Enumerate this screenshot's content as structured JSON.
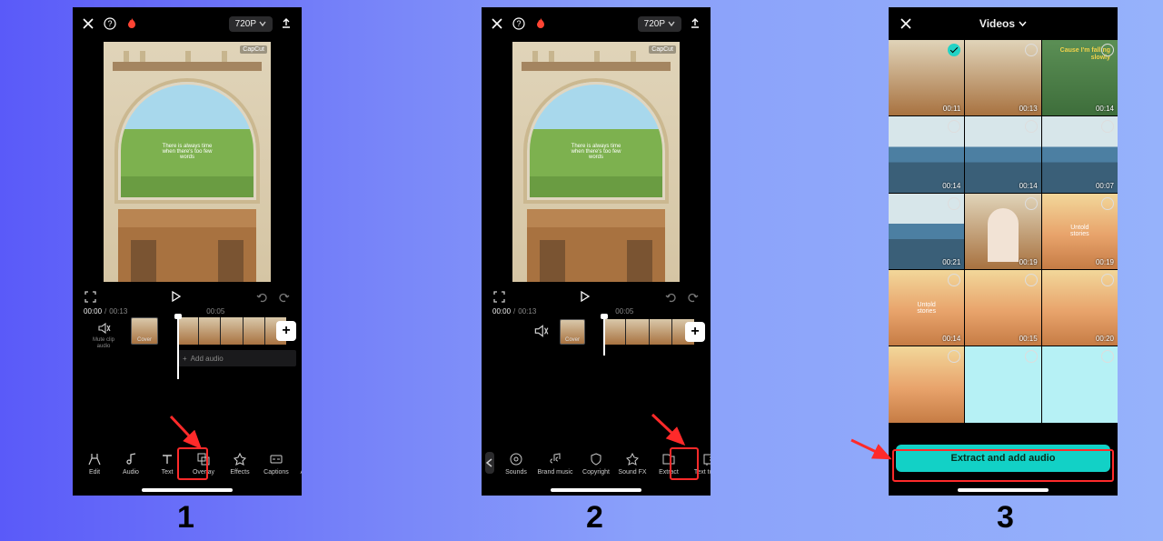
{
  "topbar": {
    "resolution": "720P",
    "watermark": "CapCut"
  },
  "transport": {
    "current_time": "00:00",
    "total_time": "00:13",
    "ruler_label": "00:05"
  },
  "timeline": {
    "mute_label_1": "Mute clip",
    "mute_label_2": "audio",
    "cover_label": "Cover",
    "add_audio": "Add audio"
  },
  "tools1": {
    "edit": "Edit",
    "audio": "Audio",
    "text": "Text",
    "overlay": "Overlay",
    "effects": "Effects",
    "captions": "Captions",
    "aspect": "Aspect ratio"
  },
  "tools2": {
    "sounds": "Sounds",
    "brand": "Brand music",
    "copyright": "Copyright",
    "soundfx": "Sound FX",
    "extract": "Extract",
    "tta": "Text to aud"
  },
  "picker": {
    "title": "Videos",
    "button": "Extract and add audio",
    "items": [
      {
        "dur": "00:11",
        "selected": true,
        "scene": "room"
      },
      {
        "dur": "00:13",
        "selected": false,
        "scene": "room"
      },
      {
        "dur": "00:14",
        "selected": false,
        "scene": "green",
        "text": "Cause I'm falling slowly"
      },
      {
        "dur": "00:14",
        "selected": false,
        "scene": "boats"
      },
      {
        "dur": "00:14",
        "selected": false,
        "scene": "boats"
      },
      {
        "dur": "00:07",
        "selected": false,
        "scene": "boats"
      },
      {
        "dur": "00:21",
        "selected": false,
        "scene": "boats"
      },
      {
        "dur": "00:19",
        "selected": false,
        "scene": "person"
      },
      {
        "dur": "00:19",
        "selected": false,
        "scene": "sunset",
        "text2": "Untold stories"
      },
      {
        "dur": "00:14",
        "selected": false,
        "scene": "sunset",
        "text2": "Untold stories"
      },
      {
        "dur": "00:15",
        "selected": false,
        "scene": "sunset"
      },
      {
        "dur": "00:20",
        "selected": false,
        "scene": "sunset"
      },
      {
        "dur": "",
        "selected": false,
        "scene": "sunset"
      },
      {
        "dur": "",
        "selected": false,
        "scene": "solid"
      },
      {
        "dur": "",
        "selected": false,
        "scene": "solid"
      }
    ]
  },
  "steps": {
    "one": "1",
    "two": "2",
    "three": "3"
  }
}
